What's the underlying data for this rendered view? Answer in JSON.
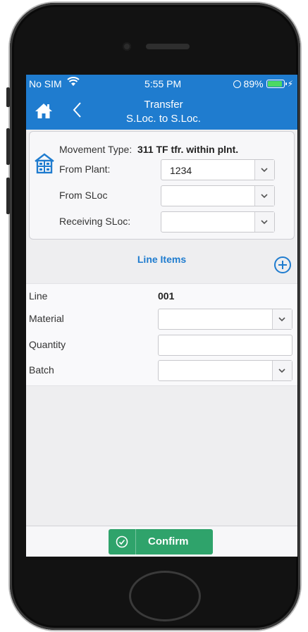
{
  "status_bar": {
    "carrier": "No SIM",
    "time": "5:55 PM",
    "battery_percent": "89%",
    "battery_level": 0.89,
    "wifi_icon": "wifi-icon",
    "charge_icon": "charge-icon"
  },
  "nav": {
    "title_line1": "Transfer",
    "title_line2": "S.Loc. to S.Loc.",
    "home_icon": "home-icon",
    "back_icon": "back-icon"
  },
  "header": {
    "movement_type_label": "Movement Type:",
    "movement_type_value": "311 TF tfr. within plnt.",
    "from_plant_label": "From Plant:",
    "from_plant_value": "1234",
    "from_sloc_label": "From SLoc",
    "from_sloc_value": "",
    "receiving_sloc_label": "Receiving SLoc:",
    "receiving_sloc_value": ""
  },
  "line_items": {
    "title": "Line Items",
    "line_label": "Line",
    "line_value": "001",
    "material_label": "Material",
    "material_value": "",
    "quantity_label": "Quantity",
    "quantity_value": "",
    "batch_label": "Batch",
    "batch_value": ""
  },
  "footer": {
    "confirm_label": "Confirm"
  },
  "colors": {
    "accent": "#1f7ccf",
    "confirm": "#2fa36b",
    "background": "#eeeef0"
  }
}
